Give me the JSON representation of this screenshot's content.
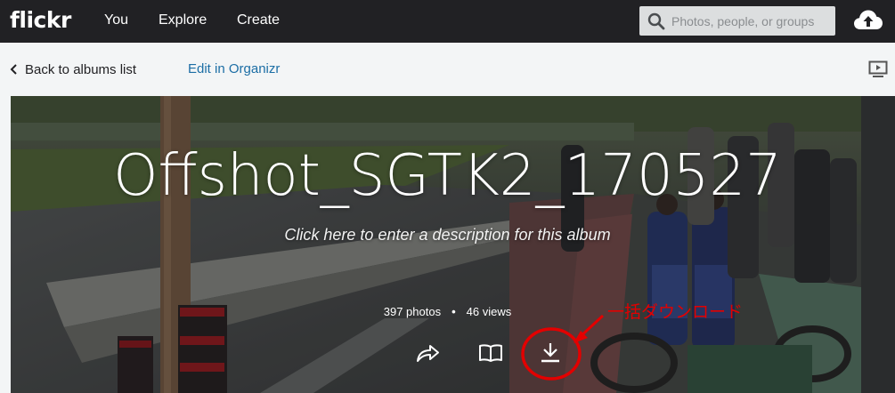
{
  "nav": {
    "logo": "flickr",
    "links": [
      "You",
      "Explore",
      "Create"
    ],
    "search_placeholder": "Photos, people, or groups",
    "upload_icon": "cloud-upload-icon"
  },
  "subbar": {
    "back_label": "Back to albums list",
    "edit_label": "Edit in Organizr",
    "slideshow_icon": "slideshow-icon"
  },
  "album": {
    "title": "Offshot_SGTK2_170527",
    "description_placeholder": "Click here to enter a description for this album",
    "photos": "397 photos",
    "separator": "•",
    "views": "46 views",
    "actions": [
      "share-icon",
      "book-icon",
      "download-icon"
    ]
  },
  "annotation": {
    "text": "一括ダウンロード",
    "color": "#e30000"
  },
  "colors": {
    "nav_bg": "#212124",
    "subbar_bg": "#f3f5f6",
    "link_blue": "#1c6ea5",
    "annotation_red": "#e30000"
  }
}
